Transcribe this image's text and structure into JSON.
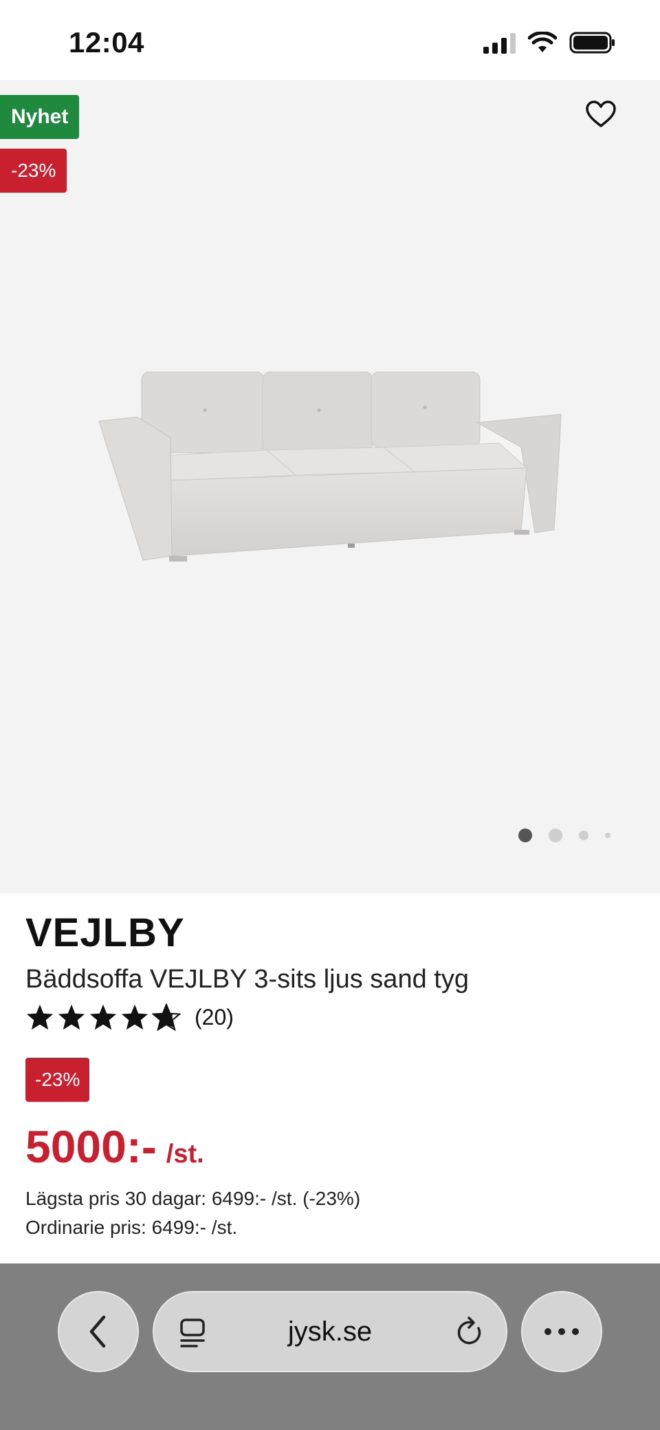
{
  "status_bar": {
    "time": "12:04"
  },
  "product_gallery": {
    "badge_new": "Nyhet",
    "badge_discount": "-23%",
    "active_image_index": 0,
    "image_count": 4
  },
  "product": {
    "brand": "VEJLBY",
    "title": "Bäddsoffa VEJLBY 3-sits ljus sand tyg",
    "rating_stars": 4.5,
    "rating_count": "(20)",
    "discount_badge": "-23%",
    "price": "5000:-",
    "price_unit": "/st.",
    "lowest_price_text": "Lägsta pris 30 dagar: 6499:- /st. (-23%)",
    "regular_price_text": "Ordinarie pris: 6499:- /st."
  },
  "browser": {
    "url": "jysk.se"
  },
  "colors": {
    "new_badge": "#1f8a3e",
    "discount_red": "#c8202f",
    "image_background": "#f3f3f3",
    "browser_bar": "#808080"
  }
}
